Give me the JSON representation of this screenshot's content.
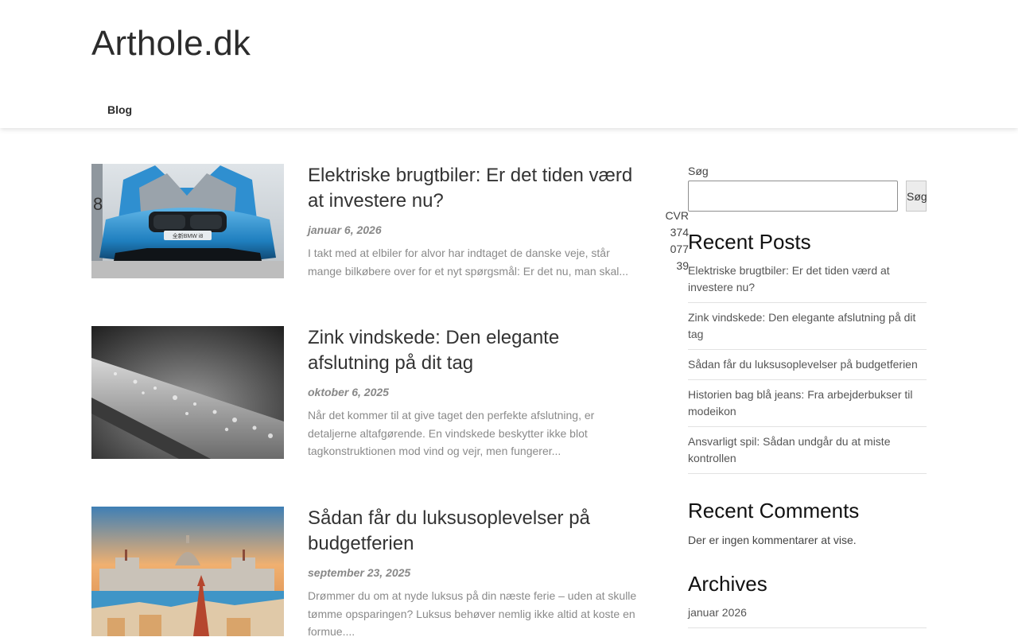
{
  "site": {
    "title": "Arthole.dk",
    "nav": [
      {
        "label": "Blog"
      }
    ]
  },
  "posts": [
    {
      "title": "Elektriske brugtbiler: Er det tiden værd at investere nu?",
      "date": "januar 6, 2026",
      "excerpt": "I takt med at elbiler for alvor har indtaget de danske veje, står mange bilkøbere over for et nyt spørgsmål: Er det nu, man skal...",
      "image_text": "全新BMW i8",
      "image_edge_text": "8"
    },
    {
      "title": "Zink vindskede: Den elegante afslutning på dit tag",
      "date": "oktober 6, 2025",
      "excerpt": "Når det kommer til at give taget den perfekte afslutning, er detaljerne altafgørende. En vindskede beskytter ikke blot tagkonstruktionen mod vind og vejr, men fungerer..."
    },
    {
      "title": "Sådan får du luksusoplevelser på budgetferien",
      "date": "september 23, 2025",
      "excerpt": "Drømmer du om at nyde luksus på din næste ferie – uden at skulle tømme opsparingen? Luksus behøver nemlig ikke altid at koste en formue...."
    }
  ],
  "cvr": {
    "lines": [
      "CVR",
      "374",
      "077",
      "39"
    ]
  },
  "sidebar": {
    "search": {
      "label": "Søg",
      "button": "Søg",
      "value": ""
    },
    "recent_posts": {
      "title": "Recent Posts",
      "items": [
        "Elektriske brugtbiler: Er det tiden værd at investere nu?",
        "Zink vindskede: Den elegante afslutning på dit tag",
        "Sådan får du luksusoplevelser på budgetferien",
        "Historien bag blå jeans: Fra arbejderbukser til modeikon",
        "Ansvarligt spil: Sådan undgår du at miste kontrollen"
      ]
    },
    "recent_comments": {
      "title": "Recent Comments",
      "empty_text": "Der er ingen kommentarer at vise."
    },
    "archives": {
      "title": "Archives",
      "items": [
        "januar 2026"
      ]
    }
  },
  "colors": {
    "accent": "#2c2c2c",
    "muted_text": "#8a8a8a",
    "divider": "#e2e2e2"
  }
}
